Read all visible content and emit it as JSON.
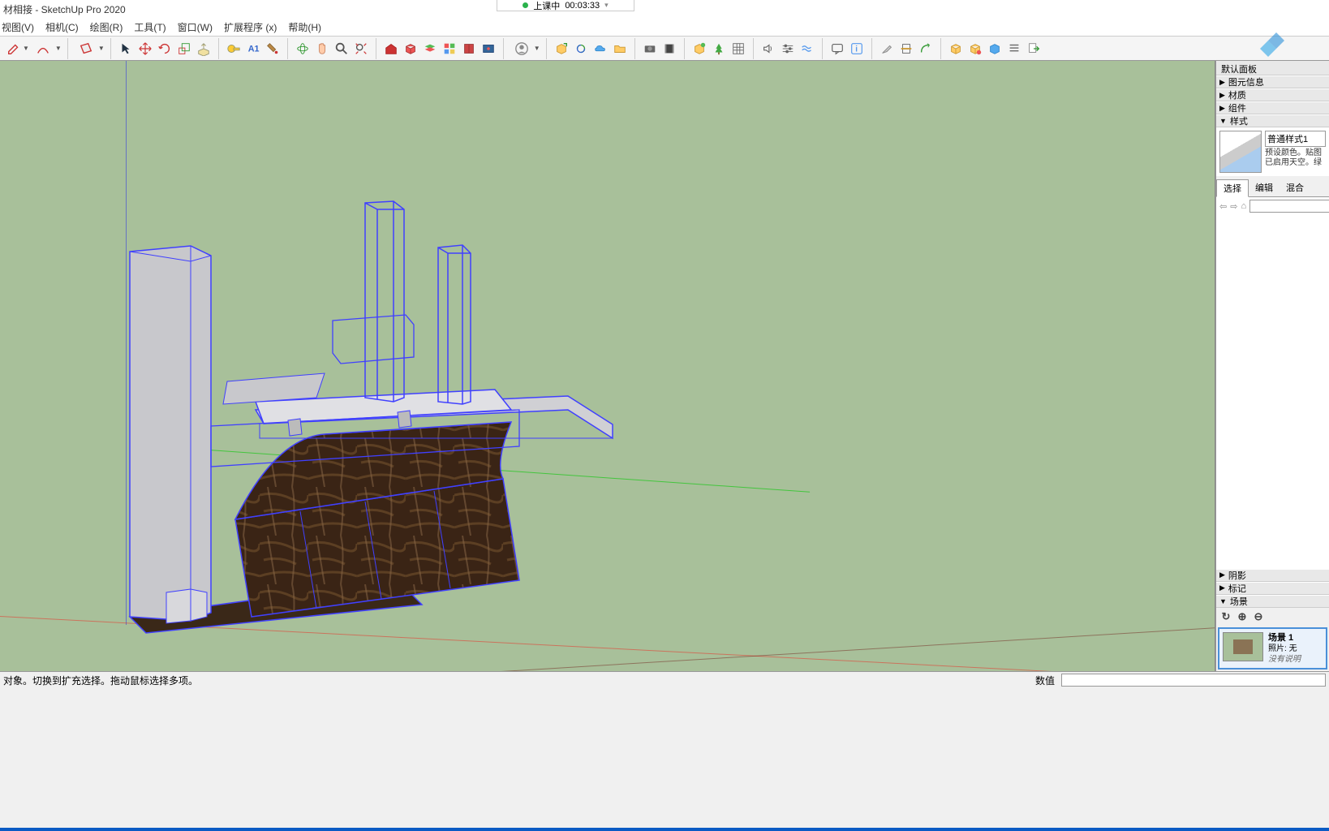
{
  "title": "材相接 - SketchUp Pro 2020",
  "overlay": {
    "label": "上课中",
    "time": "00:03:33"
  },
  "menu": [
    "视图(V)",
    "相机(C)",
    "绘图(R)",
    "工具(T)",
    "窗口(W)",
    "扩展程序 (x)",
    "帮助(H)"
  ],
  "tray": {
    "title": "默认面板",
    "sections": {
      "entity": "图元信息",
      "materials": "材质",
      "components": "组件",
      "styles": "样式",
      "shadow": "阴影",
      "tags": "标记",
      "scenes": "场景"
    },
    "style": {
      "name": "普通样式1",
      "desc": "预设颜色。贴图已启用天空。绿",
      "tabs": [
        "选择",
        "编辑",
        "混合"
      ]
    },
    "scene": {
      "name": "场景 1",
      "photo_label": "照片:",
      "photo_value": "无",
      "note": "没有说明"
    }
  },
  "status": {
    "hint": "对象。切换到扩充选择。拖动鼠标选择多项。",
    "value_label": "数值"
  }
}
